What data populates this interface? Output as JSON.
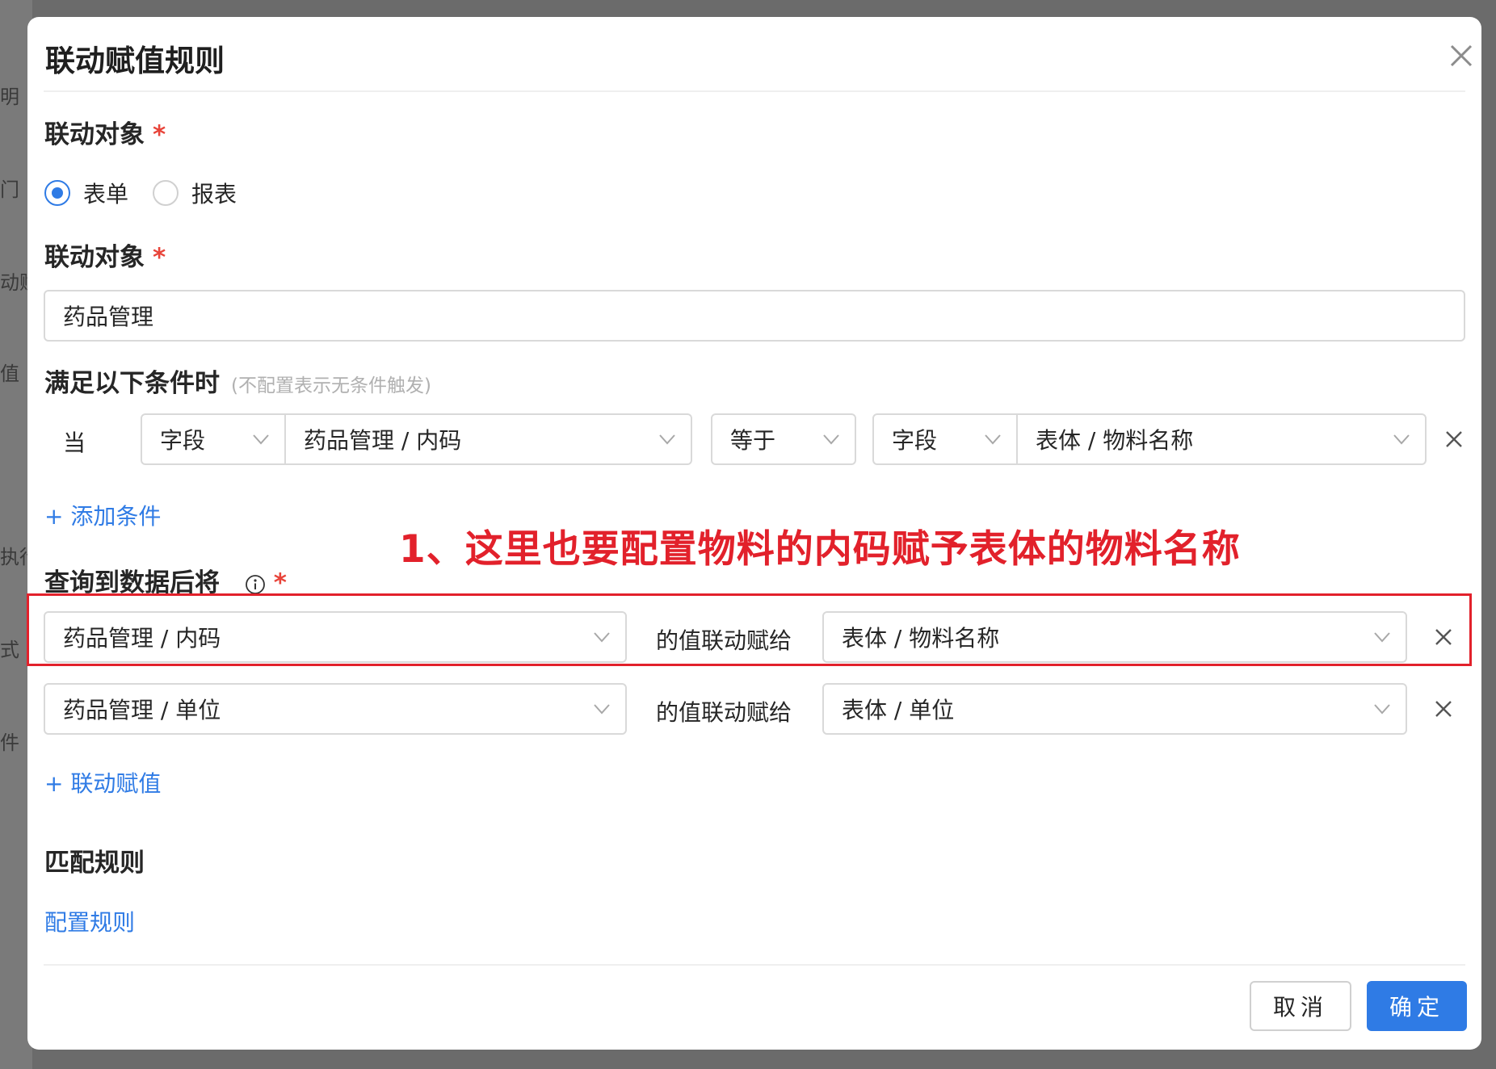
{
  "background": {
    "side_labels": [
      "明",
      "门",
      "动赋",
      "值",
      "执行",
      "式",
      "件"
    ]
  },
  "dialog": {
    "title": "联动赋值规则",
    "close_icon": "close-icon"
  },
  "target_type": {
    "label": "联动对象",
    "required_mark": "*",
    "options": [
      "表单",
      "报表"
    ],
    "selected": "表单"
  },
  "target_object": {
    "label": "联动对象",
    "required_mark": "*",
    "value": "药品管理"
  },
  "conditions": {
    "label": "满足以下条件时",
    "hint": "(不配置表示无条件触发)",
    "row": {
      "when_label": "当",
      "left_type": "字段",
      "left_field": "药品管理 / 内码",
      "operator": "等于",
      "right_type": "字段",
      "right_field": "表体 / 物料名称"
    },
    "add_label": "+ 添加条件"
  },
  "annotation": {
    "text": "1、这里也要配置物料的内码赋予表体的物料名称",
    "color": "#e2212b"
  },
  "assignments": {
    "label": "查询到数据后将",
    "info_icon": "info-icon",
    "required_mark": "*",
    "rows": [
      {
        "source": "药品管理 / 内码",
        "connector": "的值联动赋给",
        "target": "表体 / 物料名称"
      },
      {
        "source": "药品管理 / 单位",
        "connector": "的值联动赋给",
        "target": "表体 / 单位"
      }
    ],
    "add_label": "+ 联动赋值"
  },
  "match_rules": {
    "label": "匹配规则",
    "link": "配置规则"
  },
  "footer": {
    "cancel_label": "取消",
    "ok_label": "确定"
  },
  "colors": {
    "accent": "#2f7be5",
    "required": "#e8443a",
    "annotation": "#e2212b"
  }
}
